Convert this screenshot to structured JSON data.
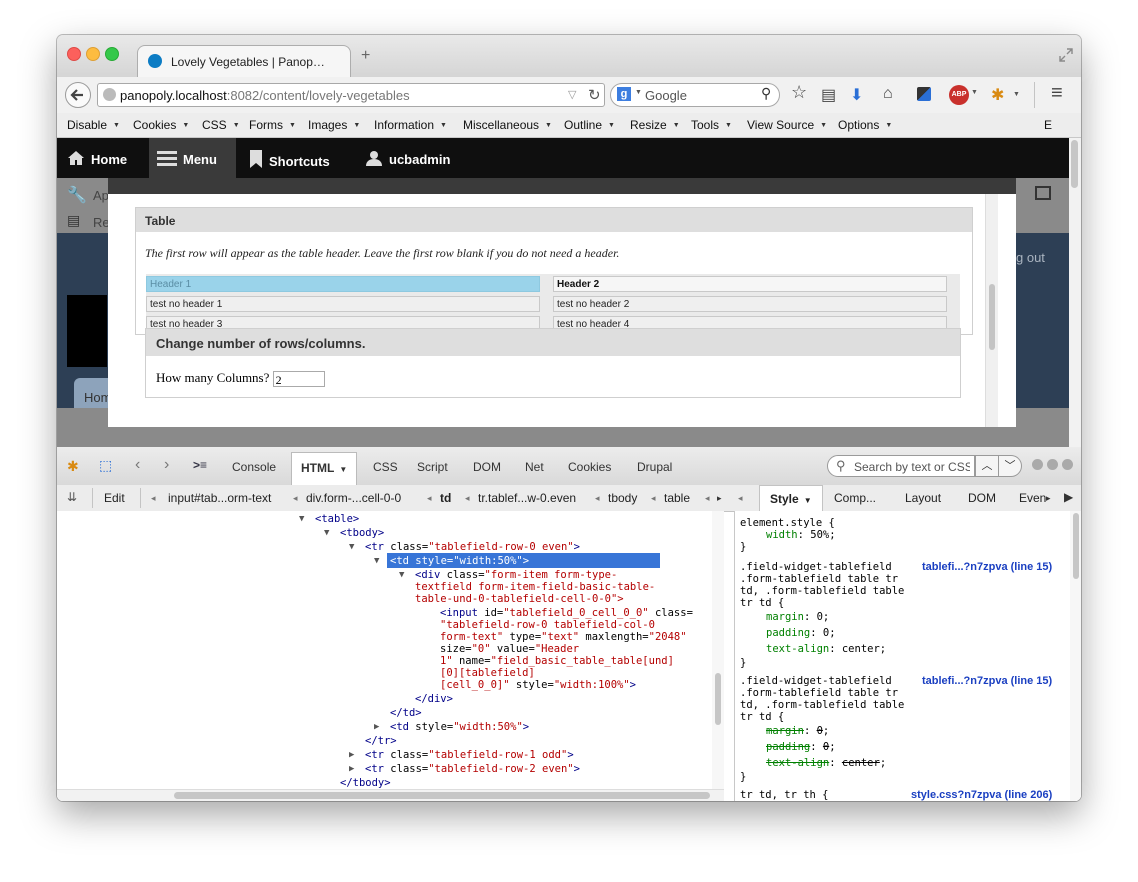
{
  "browser": {
    "tab_title": "Lovely Vegetables | Panop…",
    "new_tab": "+",
    "url_host": "panopoly.localhost",
    "url_rest": ":8082/content/lovely-vegetables",
    "search_engine": "Google",
    "search_placeholder": "Google"
  },
  "menubar": {
    "items": [
      "Disable",
      "Cookies",
      "CSS",
      "Forms",
      "Images",
      "Information",
      "Miscellaneous",
      "Outline",
      "Resize",
      "Tools",
      "View Source",
      "Options"
    ],
    "trailing": "E"
  },
  "admin_toolbar": {
    "home": "Home",
    "menu": "Menu",
    "shortcuts": "Shortcuts",
    "user": "ucbadmin"
  },
  "background_page": {
    "app_label": "Ap",
    "re_label": "Re",
    "logout": "g out",
    "home_tab": "Hom"
  },
  "modal": {
    "table_legend": "Table",
    "description": "The first row will appear as the table header. Leave the first row blank if you do not need a header.",
    "rows": [
      [
        "Header 1",
        "Header 2"
      ],
      [
        "test no header 1",
        "test no header 2"
      ],
      [
        "test no header 3",
        "test no header 4"
      ]
    ],
    "change_legend": "Change number of rows/columns.",
    "columns_label": "How many Columns?",
    "columns_value": "2"
  },
  "firebug": {
    "tabs": [
      "Console",
      "HTML",
      "CSS",
      "Script",
      "DOM",
      "Net",
      "Cookies",
      "Drupal"
    ],
    "selected_tab": "HTML",
    "search_placeholder": "Search by text or CSS",
    "edit": "Edit",
    "breadcrumbs": [
      "input#tab...orm-text",
      "div.form-...cell-0-0",
      "td",
      "tr.tablef...w-0.even",
      "tbody",
      "table"
    ],
    "side_tabs": [
      "Style",
      "Comp...",
      "Layout",
      "DOM",
      "Even"
    ],
    "html_lines": {
      "l1": "<table>",
      "l2": "<tbody>",
      "l3a": "<tr ",
      "l3b": "class=",
      "l3c": "\"tablefield-row-0 even\"",
      "l3d": ">",
      "l4": "<td style=\"width:50%\">",
      "l5a": "<div ",
      "l5b": "class=",
      "l5c": "\"form-item form-type-",
      "l6": "textfield form-item-field-basic-table-",
      "l7": "table-und-0-tablefield-cell-0-0\">",
      "l8a": "<input ",
      "l8b": "id=",
      "l8c": "\"tablefield_0_cell_0_0\"",
      "l8d": " class=",
      "l9": "\"tablefield-row-0 tablefield-col-0",
      "l10a": "form-text\"",
      "l10b": " type=",
      "l10c": "\"text\"",
      "l10d": " maxlength=",
      "l10e": "\"2048\"",
      "l11a": "size=",
      "l11b": "\"0\"",
      "l11c": " value=",
      "l11d": "\"Header",
      "l12a": "1\"",
      "l12b": " name=",
      "l12c": "\"field_basic_table_table[und]",
      "l13": "[0][tablefield]",
      "l14a": "[cell_0_0]\"",
      "l14b": " style=",
      "l14c": "\"width:100%\"",
      "l14d": ">",
      "l15": "</div>",
      "l16": "</td>",
      "l17a": "<td ",
      "l17b": "style=",
      "l17c": "\"width:50%\"",
      "l17d": ">",
      "l18": "</tr>",
      "l19a": "<tr ",
      "l19b": "class=",
      "l19c": "\"tablefield-row-1 odd\"",
      "l19d": ">",
      "l20a": "<tr ",
      "l20b": "class=",
      "l20c": "\"tablefield-row-2 even\"",
      "l20d": ">",
      "l21": "</tbody>"
    },
    "style_lines": {
      "s1": "element.style {",
      "s2p": "width",
      "s2v": ": 50%;",
      "s3": "}",
      "r1a": ".field-widget-tablefield",
      "r1b": ".form-tablefield table tr",
      "r1c": "td, .form-tablefield table",
      "r1d": "tr td {",
      "r1p1": "margin",
      "r1v1": ": 0;",
      "r1p2": "padding",
      "r1v2": ": 0;",
      "r1p3": "text-align",
      "r1v3": ": center;",
      "r1e": "}",
      "r1link": "tablefi...?n7zpva (line 15)",
      "r2a": ".field-widget-tablefield",
      "r2b": ".form-tablefield table tr",
      "r2c": "td, .form-tablefield table",
      "r2d": "tr td {",
      "r2p1": "margin",
      "r2v1": "0",
      "r2p2": "padding",
      "r2v2": "0",
      "r2p3": "text-align",
      "r2v3": "center",
      "r2e": "}",
      "r2link": "tablefi...?n7zpva (line 15)",
      "r3a": "tr td, tr th {",
      "r3link": "style.css?n7zpva (line 206)"
    }
  },
  "colors": {
    "selection": "#3875d7",
    "tag": "#000088",
    "value": "#b40000",
    "css_property": "#008000",
    "link": "#1a3fc1",
    "highlight_cell": "#9ad3ea"
  }
}
